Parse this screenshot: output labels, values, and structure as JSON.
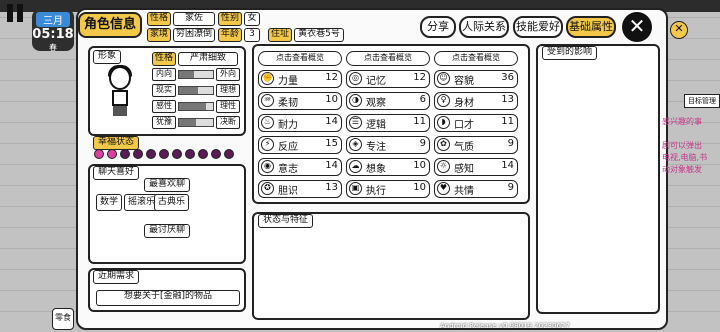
{
  "date": {
    "month": "三月",
    "time": "05:18",
    "season": "春"
  },
  "header": {
    "title": "角色信息",
    "close": "✕"
  },
  "profile": [
    {
      "label": "性格",
      "value": "家佐"
    },
    {
      "label": "性别",
      "value": "女"
    },
    {
      "label": "家境",
      "value": "穷困潦倒"
    },
    {
      "label": "年龄",
      "value": "3"
    },
    {
      "label": "住址",
      "value": "黄衣巷5号"
    }
  ],
  "tabs": [
    {
      "label": "分享"
    },
    {
      "label": "人际关系"
    },
    {
      "label": "技能爱好"
    },
    {
      "label": "基础属性"
    }
  ],
  "appearance": {
    "title": "形象",
    "personality_label": "性格",
    "personality_value": "严肃细致",
    "traits": [
      {
        "left": "内向",
        "right": "外向",
        "level": 0.45
      },
      {
        "left": "现实",
        "right": "理想",
        "level": 0.55
      },
      {
        "left": "感性",
        "right": "理性",
        "level": 0.8
      },
      {
        "left": "犹豫",
        "right": "决断",
        "level": 0.5
      }
    ]
  },
  "happiness": {
    "title": "幸福状态",
    "hearts_filled": 2,
    "hearts_total": 11
  },
  "chat": {
    "title": "聊天喜好",
    "likes_title": "最喜欢聊",
    "likes": [
      "数学",
      "摇滚乐",
      "古典乐"
    ],
    "dislikes_title": "最讨厌聊"
  },
  "recent": {
    "title": "近期需求",
    "text": "想要关于[金融]的物品"
  },
  "attributes": {
    "header": "点击查看概览",
    "col1": [
      {
        "icon": "strength-icon",
        "name": "力量",
        "value": "12"
      },
      {
        "icon": "toughness-icon",
        "name": "柔韧",
        "value": "10"
      },
      {
        "icon": "stamina-icon",
        "name": "耐力",
        "value": "14"
      },
      {
        "icon": "reaction-icon",
        "name": "反应",
        "value": "15"
      },
      {
        "icon": "will-icon",
        "name": "意志",
        "value": "14"
      },
      {
        "icon": "courage-icon",
        "name": "胆识",
        "value": "13"
      }
    ],
    "col2": [
      {
        "icon": "memory-icon",
        "name": "记忆",
        "value": "12"
      },
      {
        "icon": "observe-icon",
        "name": "观察",
        "value": "6"
      },
      {
        "icon": "logic-icon",
        "name": "逻辑",
        "value": "11"
      },
      {
        "icon": "focus-icon",
        "name": "专注",
        "value": "9"
      },
      {
        "icon": "imagine-icon",
        "name": "想象",
        "value": "10"
      },
      {
        "icon": "execute-icon",
        "name": "执行",
        "value": "10"
      }
    ],
    "col3": [
      {
        "icon": "looks-icon",
        "name": "容貌",
        "value": "36"
      },
      {
        "icon": "figure-icon",
        "name": "身材",
        "value": "13"
      },
      {
        "icon": "speech-icon",
        "name": "口才",
        "value": "11"
      },
      {
        "icon": "temperament-icon",
        "name": "气质",
        "value": "9"
      },
      {
        "icon": "perception-icon",
        "name": "感知",
        "value": "14"
      },
      {
        "icon": "empathy-icon",
        "name": "共情",
        "value": "9"
      }
    ]
  },
  "status": {
    "title": "状态与特征"
  },
  "influence": {
    "title": "受到的影响"
  },
  "side": {
    "manage": "目标管理",
    "lines": [
      "感兴趣的事",
      "剧可以弹出",
      "电视,电脑,书",
      "动对象触发"
    ],
    "food": "零食"
  },
  "version": "Android Release v0.98019 20230627"
}
